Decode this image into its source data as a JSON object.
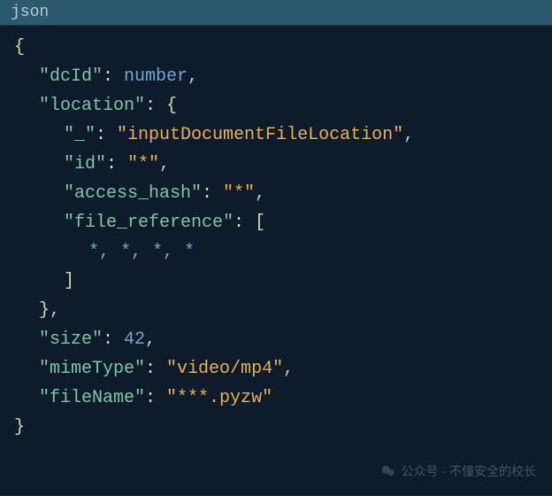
{
  "header": {
    "lang": "json"
  },
  "code": {
    "keys": {
      "dcId": "\"dcId\"",
      "location": "\"location\"",
      "underscore": "\"_\"",
      "id": "\"id\"",
      "access_hash": "\"access_hash\"",
      "file_reference": "\"file_reference\"",
      "size": "\"size\"",
      "mimeType": "\"mimeType\"",
      "fileName": "\"fileName\""
    },
    "vals": {
      "dcId": "number",
      "loc_type": "\"inputDocumentFileLocation\"",
      "id": "\"*\"",
      "access_hash": "\"*\"",
      "fr_items": "*, *, *, *",
      "size": "42",
      "mimeType": "\"video/mp4\"",
      "fileName": "\"***.pyzw\""
    },
    "sym": {
      "obr": "{",
      "cbr": "}",
      "osq": "[",
      "csq": "]",
      "colon": ": ",
      "comma": ","
    }
  },
  "watermark": {
    "text": "公众号 · 不懂安全的校长"
  }
}
